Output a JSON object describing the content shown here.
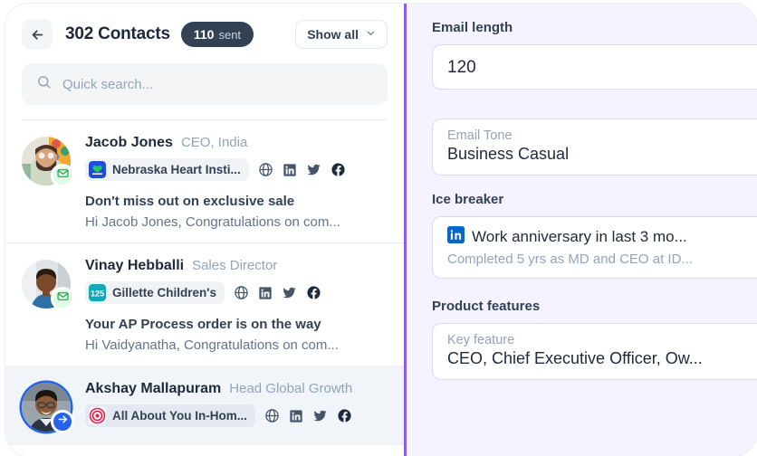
{
  "header": {
    "back_icon": "arrow-left-icon",
    "title": "302 Contacts",
    "sent_count": "110",
    "sent_label": "sent",
    "show_all_label": "Show all",
    "chevron_icon": "chevron-down-icon"
  },
  "search": {
    "icon": "search-icon",
    "placeholder": "Quick search...",
    "value": ""
  },
  "contacts": [
    {
      "name": "Jacob Jones",
      "role": "CEO, India",
      "company": "Nebraska Heart Insti...",
      "company_logo": "nebraska-heart-logo",
      "subject": "Don't miss out on exclusive sale",
      "preview": "Hi Jacob Jones, Congratulations on com...",
      "status_badge": "email-sent-icon",
      "selected": false,
      "socials": [
        "globe-icon",
        "linkedin-icon",
        "twitter-icon",
        "facebook-icon"
      ]
    },
    {
      "name": "Vinay Hebballi",
      "role": "Sales Director",
      "company": "Gillette Children's",
      "company_logo": "gillette-125-logo",
      "subject": "Your AP Process order is on the way",
      "preview": "Hi Vaidyanatha, Congratulations on com...",
      "status_badge": "email-sent-icon",
      "selected": false,
      "socials": [
        "globe-icon",
        "linkedin-icon",
        "twitter-icon",
        "facebook-icon"
      ]
    },
    {
      "name": "Akshay Mallapuram",
      "role": "Head Global Growth",
      "company": "All About You In-Hom...",
      "company_logo": "bullseye-logo",
      "subject": "",
      "preview": "",
      "status_badge": "arrow-right-icon",
      "selected": true,
      "socials": [
        "globe-icon",
        "linkedin-icon",
        "twitter-icon",
        "facebook-icon"
      ]
    }
  ],
  "panel": {
    "email_length": {
      "label": "Email length",
      "value": "120"
    },
    "email_tone": {
      "sub_label": "Email Tone",
      "value": "Business Casual"
    },
    "ice_breaker": {
      "label": "Ice breaker",
      "source_icon": "linkedin-icon",
      "title": "Work anniversary in last 3 mo...",
      "detail": "Completed 5 yrs as MD and CEO at ID..."
    },
    "product_features": {
      "label": "Product features",
      "sub_label": "Key feature",
      "value": "CEO, Chief Executive Officer, Ow..."
    }
  },
  "colors": {
    "accent_purple": "#8b5cf6",
    "panel_bg": "#f5f3ff",
    "badge_dark": "#334155",
    "selected_row": "#f1f5f9",
    "blue": "#2563eb",
    "green": "#22c55e"
  }
}
